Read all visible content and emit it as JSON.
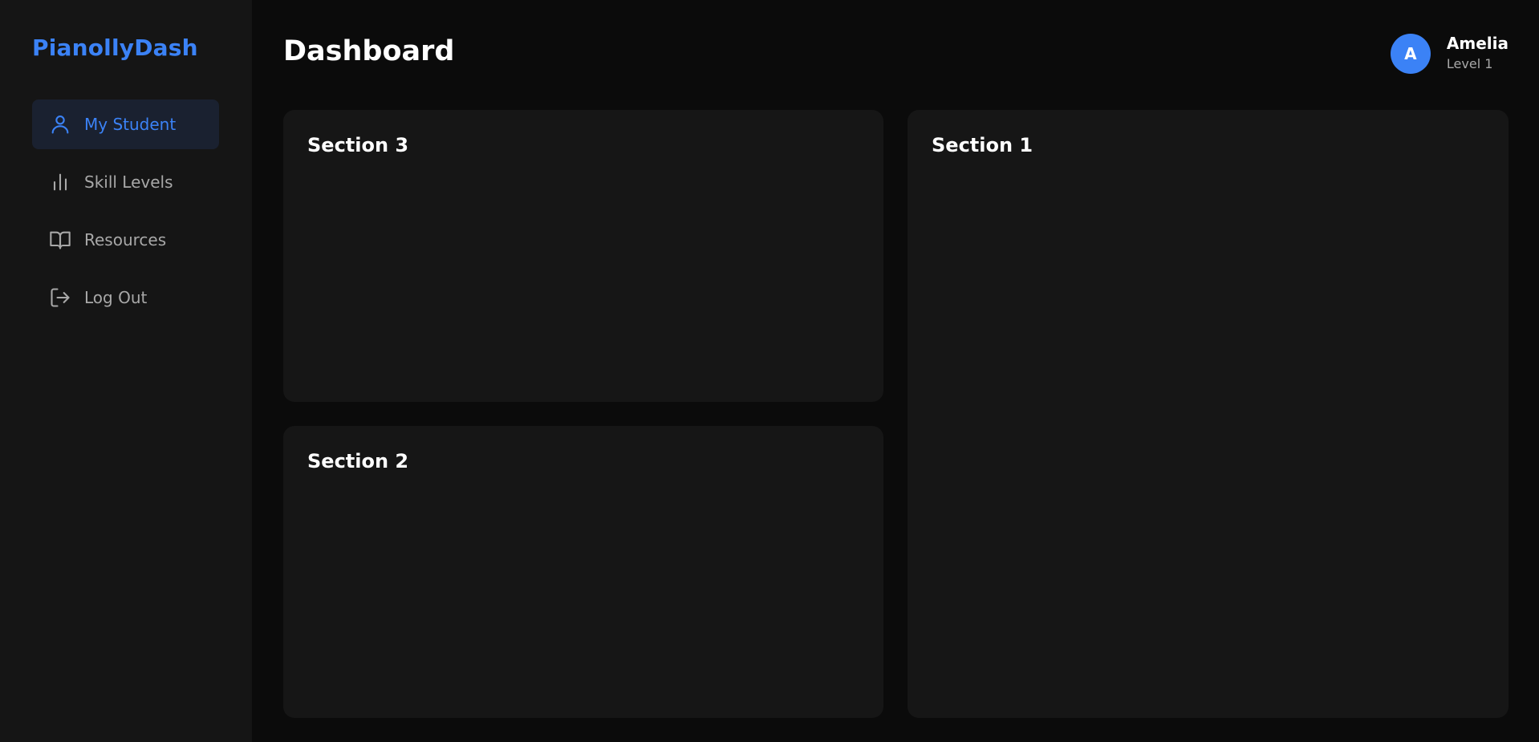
{
  "app": {
    "brand": "PianollyDash",
    "accent": "#3b82f6"
  },
  "sidebar": {
    "items": [
      {
        "label": "My Student",
        "icon": "user-icon",
        "active": true
      },
      {
        "label": "Skill Levels",
        "icon": "bar-chart-icon",
        "active": false
      },
      {
        "label": "Resources",
        "icon": "book-open-icon",
        "active": false
      },
      {
        "label": "Log Out",
        "icon": "log-out-icon",
        "active": false
      }
    ]
  },
  "header": {
    "title": "Dashboard",
    "user": {
      "initial": "A",
      "name": "Amelia",
      "level": "Level 1"
    }
  },
  "sections": {
    "section3": {
      "title": "Section 3"
    },
    "section2": {
      "title": "Section 2"
    },
    "section1": {
      "title": "Section 1"
    }
  }
}
